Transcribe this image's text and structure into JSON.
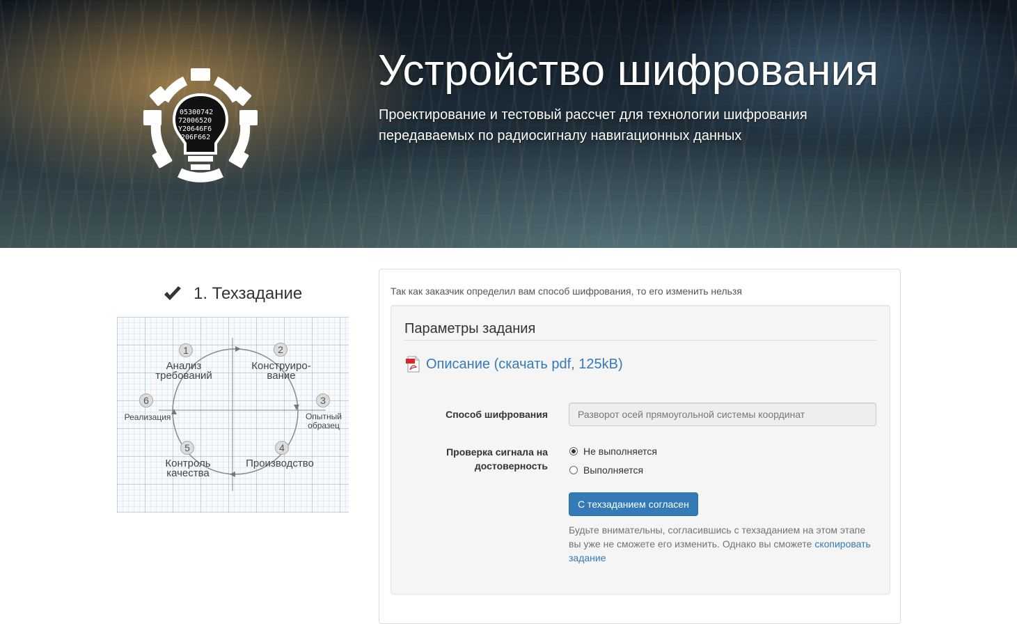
{
  "hero": {
    "title": "Устройство шифрования",
    "subtitle": "Проектирование и тестовый рассчет для технологии шифрования передаваемых по радиосигналу навигационных данных",
    "logo_icon": "gear-lightbulb-logo",
    "logo_text": [
      "05300742",
      "72006520",
      "Y20646F6",
      "206F662"
    ]
  },
  "step": {
    "title": "1. Техзадание",
    "icon": "check-icon"
  },
  "diagram": {
    "stages": [
      {
        "number": "1",
        "label_line1": "Анализ",
        "label_line2": "требований"
      },
      {
        "number": "2",
        "label_line1": "Конструиро-",
        "label_line2": "вание"
      },
      {
        "number": "3",
        "label_line1": "Опытный",
        "label_line2": "образец"
      },
      {
        "number": "4",
        "label_line1": "Производство",
        "label_line2": ""
      },
      {
        "number": "5",
        "label_line1": "Контроль",
        "label_line2": "качества"
      },
      {
        "number": "6",
        "label_line1": "Реализация",
        "label_line2": ""
      }
    ]
  },
  "panel": {
    "notice": "Так как заказчик определил вам способ шифрования, то его изменить нельзя",
    "section_title": "Параметры задания",
    "pdf_link": "Описание (скачать pdf, 125kB)",
    "pdf_icon": "pdf-file-icon",
    "cipher_label": "Способ шифрования",
    "cipher_value": "Разворот осей прямоугольной системы координат",
    "verify_label_line1": "Проверка сигнала на",
    "verify_label_line2": "достоверность",
    "radio_options": [
      {
        "label": "Не выполняется",
        "checked": true
      },
      {
        "label": "Выполняется",
        "checked": false
      }
    ],
    "agree_button": "С техзаданием согласен",
    "warning_text": "Будьте внимательны, согласившись с техзаданием на этом этапе вы уже не сможете его изменить. Однако вы сможете",
    "copy_link": "скопировать задание"
  },
  "colors": {
    "link": "#337ab7",
    "button": "#337ab7",
    "well_bg": "#f5f5f5",
    "text": "#333333"
  }
}
